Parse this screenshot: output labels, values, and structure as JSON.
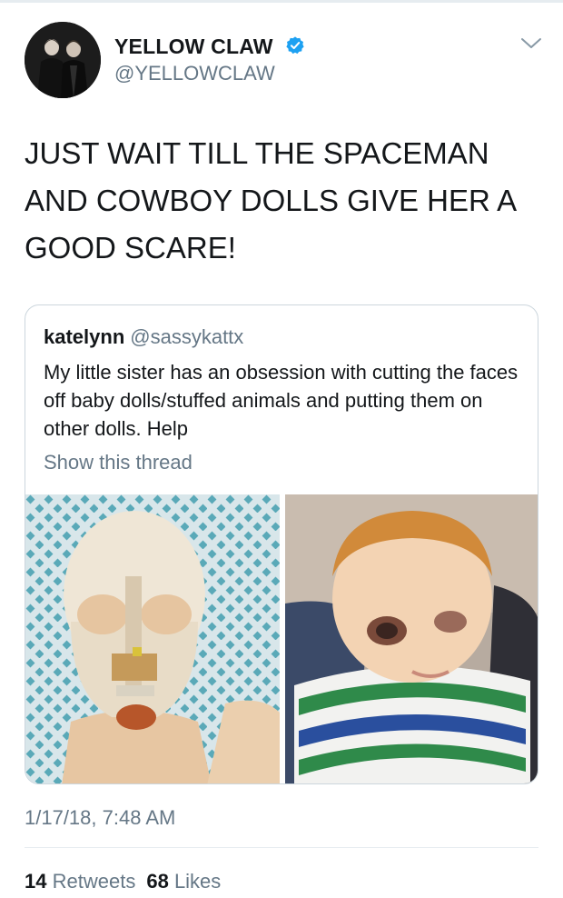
{
  "tweet": {
    "author": {
      "display_name": "YELLOW CLAW",
      "handle": "@YELLOWCLAW",
      "verified": true,
      "avatar_icon": "avatar-photo"
    },
    "text": "JUST WAIT TILL THE SPACEMAN AND COWBOY DOLLS GIVE HER A GOOD SCARE!",
    "timestamp": "1/17/18, 7:48 AM",
    "stats": {
      "retweets_count": "14",
      "retweets_label": "Retweets",
      "likes_count": "68",
      "likes_label": "Likes"
    }
  },
  "quoted_tweet": {
    "name": "katelynn",
    "handle": "@sassykattx",
    "text": "My little sister has an obsession with cutting the faces off baby dolls/stuffed animals and putting them on other dolls. Help",
    "show_thread_label": "Show this thread",
    "media": [
      {
        "icon": "doll-head-photo"
      },
      {
        "icon": "doll-baby-photo"
      }
    ]
  },
  "colors": {
    "text_primary": "#14171a",
    "text_secondary": "#657786",
    "verified_blue": "#1da1f2",
    "border": "#ccd6dd"
  }
}
